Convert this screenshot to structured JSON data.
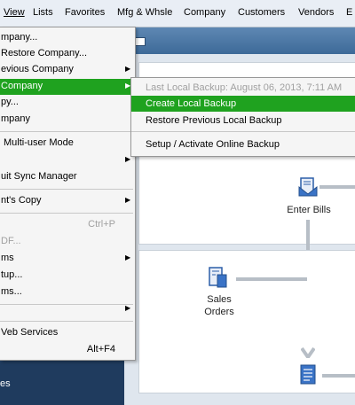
{
  "menubar": {
    "items": [
      {
        "label": "View"
      },
      {
        "label": "Lists"
      },
      {
        "label": "Favorites"
      },
      {
        "label": "Mfg & Whsle"
      },
      {
        "label": "Company"
      },
      {
        "label": "Customers"
      },
      {
        "label": "Vendors"
      },
      {
        "label": "E"
      }
    ]
  },
  "file_menu": {
    "items": [
      {
        "label": "mpany..."
      },
      {
        "label": "Restore Company..."
      },
      {
        "label": "evious Company"
      },
      {
        "label": "Company"
      },
      {
        "label": "py..."
      },
      {
        "label": "mpany"
      },
      {
        "label": "Multi-user Mode"
      },
      {
        "label": ""
      },
      {
        "label": "uit Sync Manager"
      },
      {
        "label": "nt's Copy"
      },
      {
        "label": "",
        "shortcut": "Ctrl+P"
      },
      {
        "label": "DF..."
      },
      {
        "label": "ms"
      },
      {
        "label": "tup..."
      },
      {
        "label": "ms..."
      },
      {
        "label": ""
      },
      {
        "label": "Veb Services"
      },
      {
        "label": "",
        "shortcut": "Alt+F4"
      }
    ]
  },
  "backup_submenu": {
    "items": [
      {
        "label": "Last Local Backup: August 06, 2013, 7:11 AM"
      },
      {
        "label": "Create Local Backup"
      },
      {
        "label": "Restore Previous Local Backup"
      },
      {
        "label": "Setup / Activate Online Backup"
      }
    ]
  },
  "flow": {
    "enter_bills": "Enter Bills",
    "sales_orders_line1": "Sales",
    "sales_orders_line2": "Orders"
  },
  "left_panel": {
    "label": "es"
  },
  "colors": {
    "highlight": "#1fa21f",
    "header": "#4a77a5",
    "disabled_text": "#a0a0a0"
  }
}
